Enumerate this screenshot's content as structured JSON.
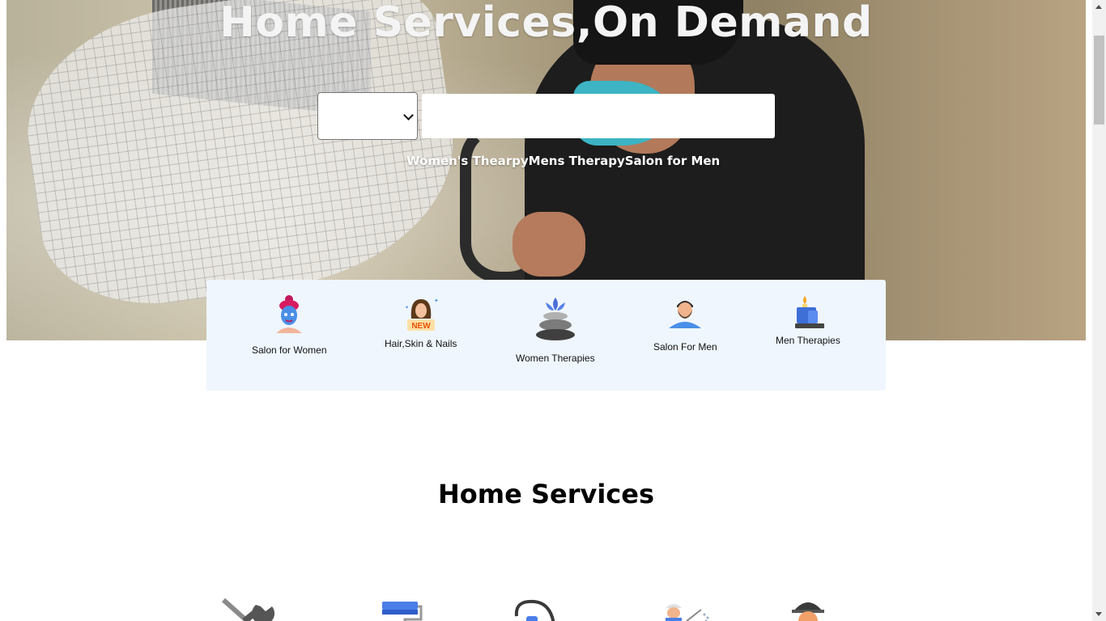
{
  "hero": {
    "title": "Home Services,On Demand",
    "search_select_value": "",
    "search_input_value": "",
    "quick_links": [
      "Women's Thearpy",
      "Mens Therapy",
      "Salon for Men"
    ]
  },
  "categories": [
    {
      "label": "Salon for Women",
      "icon": "woman-face-mask-icon"
    },
    {
      "label": "Hair,Skin & Nails",
      "icon": "new-woman-icon",
      "badge": "NEW"
    },
    {
      "label": "Women Therapies",
      "icon": "lotus-stones-icon"
    },
    {
      "label": "Salon For Men",
      "icon": "bearded-man-icon"
    },
    {
      "label": "Men Therapies",
      "icon": "candle-icon"
    }
  ],
  "section": {
    "title": "Home Services",
    "services_icons": [
      "wrench-screwdriver-icon",
      "paint-roller-icon",
      "vacuum-cleaner-icon",
      "pest-control-icon",
      "worker-helmet-icon"
    ]
  },
  "colors": {
    "category_box_bg": "#eff6fe",
    "search_input_bg": "#ffffff",
    "title_color": "#f4f4f4"
  }
}
